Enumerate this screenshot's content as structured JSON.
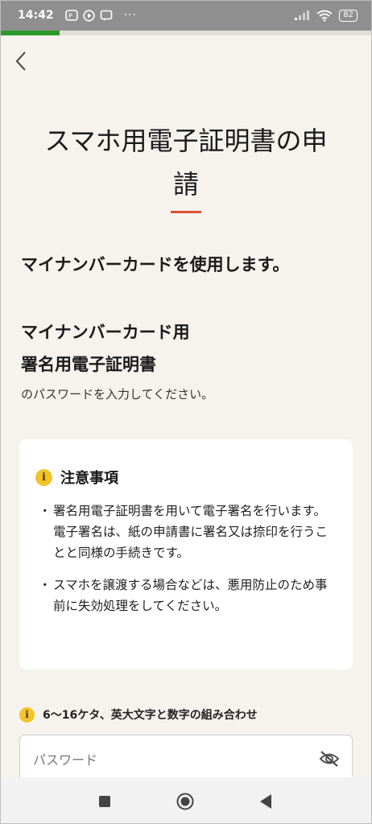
{
  "status_bar": {
    "time": "14:42",
    "dots": "···",
    "battery": "82",
    "icons": [
      "app-icon",
      "play-icon",
      "chat-icon",
      "signal-icon",
      "wifi-icon",
      "battery-icon"
    ]
  },
  "progress": {
    "fraction": 0.16,
    "color": "#2e9a2e"
  },
  "header": {
    "back_icon": "chevron-left-icon"
  },
  "title_lines": [
    "スマホ用電子証明書の申",
    "請"
  ],
  "accent_color": "#d6532e",
  "lead": "マイナンバーカードを使用します。",
  "sub_heading": {
    "line1": "マイナンバーカード用",
    "line2": "署名用電子証明書"
  },
  "sub_text": "のパスワードを入力してください。",
  "notice": {
    "icon": "info-icon",
    "icon_glyph": "i",
    "title": "注意事項",
    "items": [
      "署名用電子証明書を用いて電子署名を行います。電子署名は、紙の申請書に署名又は捺印を行うことと同様の手続きです。",
      "スマホを譲渡する場合などは、悪用防止のため事前に失効処理をしてください。"
    ]
  },
  "password": {
    "hint_icon_glyph": "i",
    "hint": "6〜16ケタ、英大文字と数字の組み合わせ",
    "placeholder": "パスワード",
    "value": "",
    "toggle_icon": "eye-off-icon"
  },
  "nav_bar": {
    "icons": [
      "recent-apps-icon",
      "home-icon",
      "back-icon"
    ]
  }
}
